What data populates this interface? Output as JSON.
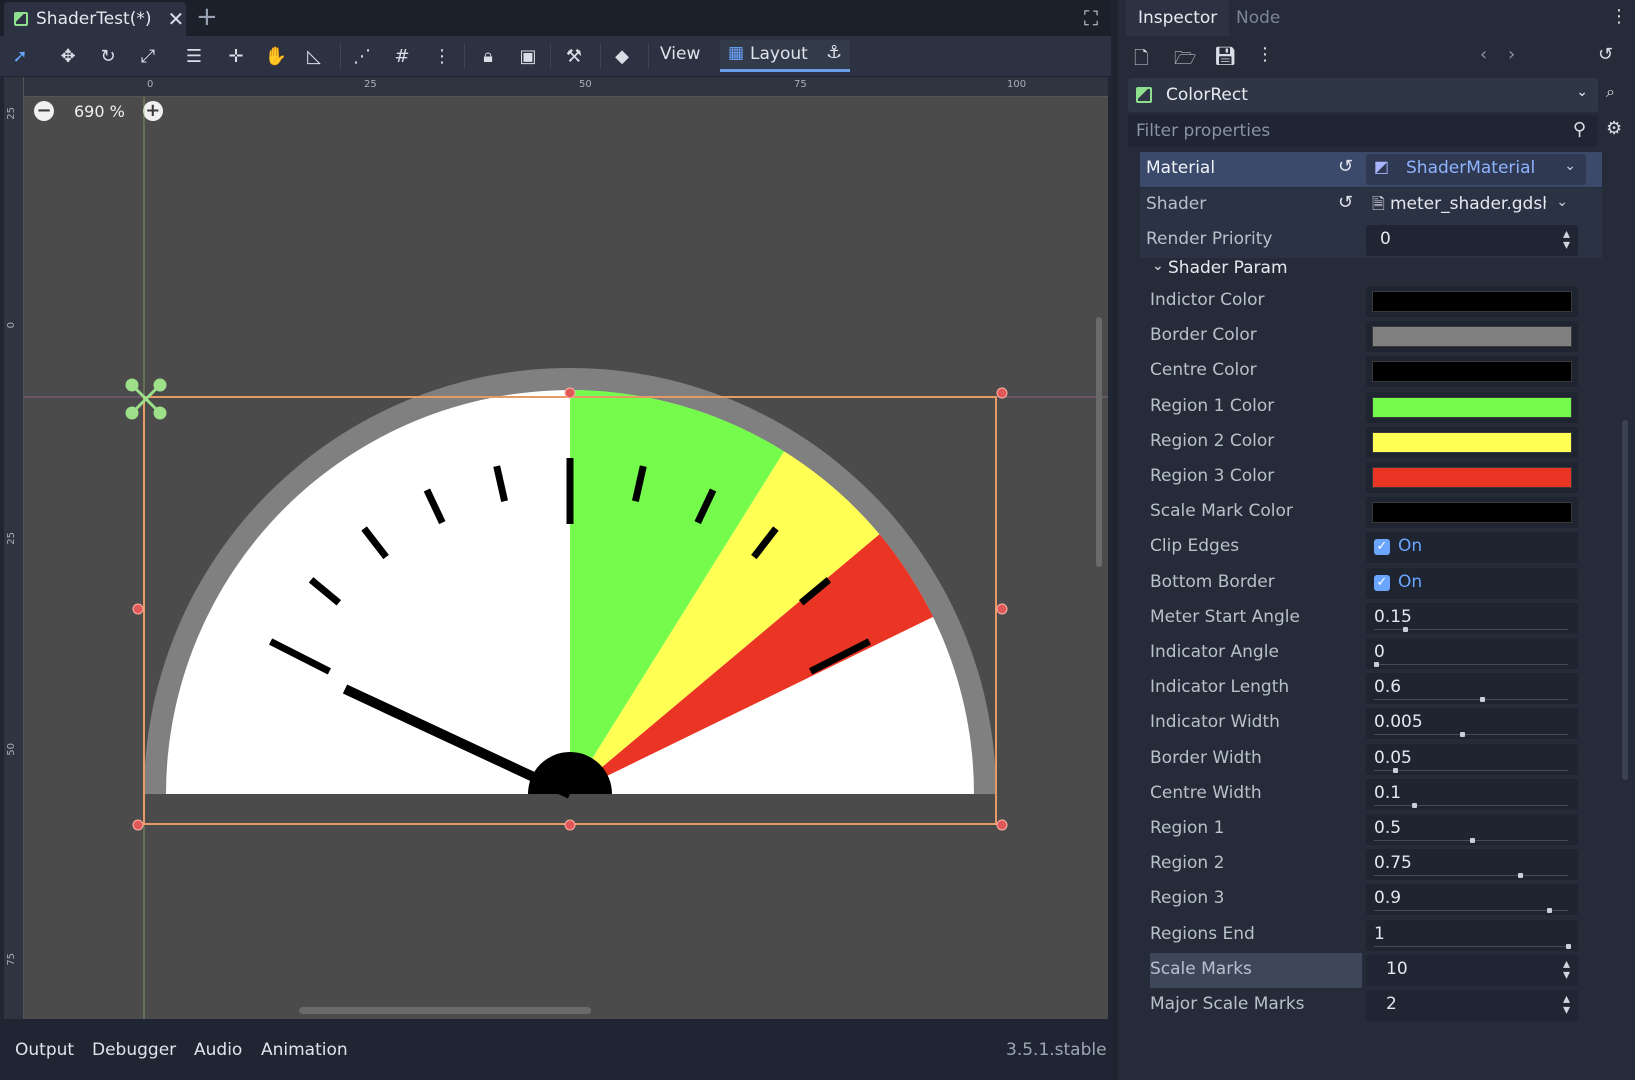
{
  "editor": {
    "scene_tab": "ShaderTest(*)",
    "toolbar": {
      "view_label": "View",
      "layout_label": "Layout"
    },
    "zoom": "690 %",
    "ruler_top": [
      "0",
      "25",
      "50",
      "75",
      "100"
    ],
    "ruler_left": [
      "25",
      "0",
      "25",
      "50",
      "75"
    ],
    "bottom_tabs": [
      "Output",
      "Debugger",
      "Audio",
      "Animation"
    ],
    "version": "3.5.1.stable"
  },
  "meter": {
    "border_color": "#808080",
    "region1_color": "#75fb4c",
    "region2_color": "#ffff54",
    "region3_color": "#eb3524",
    "indicator_color": "#000000",
    "centre_color": "#000000"
  },
  "inspector": {
    "tabs": [
      "Inspector",
      "Node"
    ],
    "node_name": "ColorRect",
    "filter_placeholder": "Filter properties",
    "material_label": "Material",
    "material_value": "ShaderMaterial",
    "shader_label": "Shader",
    "shader_value": "meter_shader.gdshader",
    "render_priority_label": "Render Priority",
    "render_priority_value": "0",
    "shader_param_label": "Shader Param",
    "colors": [
      {
        "label": "Indictor Color",
        "color": "#000000"
      },
      {
        "label": "Border Color",
        "color": "#808080"
      },
      {
        "label": "Centre Color",
        "color": "#000000"
      },
      {
        "label": "Region 1 Color",
        "color": "#75fb4c"
      },
      {
        "label": "Region 2 Color",
        "color": "#ffff54"
      },
      {
        "label": "Region 3 Color",
        "color": "#eb3524"
      },
      {
        "label": "Scale Mark Color",
        "color": "#000000"
      }
    ],
    "checks": [
      {
        "label": "Clip Edges",
        "value": "On"
      },
      {
        "label": "Bottom Border",
        "value": "On"
      }
    ],
    "floats": [
      {
        "label": "Meter Start Angle",
        "value": "0.15",
        "ratio": 0.15
      },
      {
        "label": "Indicator Angle",
        "value": "0",
        "ratio": 0.0
      },
      {
        "label": "Indicator Length",
        "value": "0.6",
        "ratio": 0.55
      },
      {
        "label": "Indicator Width",
        "value": "0.005",
        "ratio": 0.45
      },
      {
        "label": "Border Width",
        "value": "0.05",
        "ratio": 0.1
      },
      {
        "label": "Centre Width",
        "value": "0.1",
        "ratio": 0.2
      },
      {
        "label": "Region 1",
        "value": "0.5",
        "ratio": 0.5
      },
      {
        "label": "Region 2",
        "value": "0.75",
        "ratio": 0.75
      },
      {
        "label": "Region 3",
        "value": "0.9",
        "ratio": 0.9
      },
      {
        "label": "Regions End",
        "value": "1",
        "ratio": 1.0
      }
    ],
    "ints": [
      {
        "label": "Scale Marks",
        "value": "10"
      },
      {
        "label": "Major Scale Marks",
        "value": "2"
      }
    ]
  }
}
